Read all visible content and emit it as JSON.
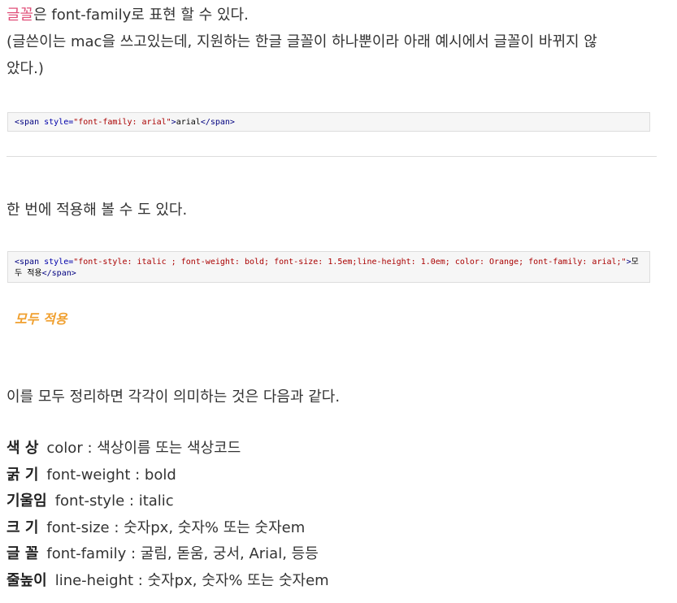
{
  "intro": {
    "highlight": "글꼴",
    "rest": "은 font-family로 표현 할 수 있다.",
    "note_line1": "(글쓴이는 mac을 쓰고있는데, 지원하는 한글 글꼴이 하나뿐이라 아래 예시에서 글꼴이 바뀌지 않",
    "note_line2": "았다.)"
  },
  "code1": {
    "open": "<span ",
    "attr": "style=",
    "value": "\"font-family: arial\"",
    "close_open": ">",
    "text": "arial",
    "end": "</span>"
  },
  "section2": {
    "text": "한 번에 적용해 볼 수 도 있다."
  },
  "code2": {
    "open": "<span ",
    "attr": "style=",
    "value": "\"font-style: italic ; font-weight: bold; font-size: 1.5em;line-height: 1.0em; color: Orange; font-family: arial;\"",
    "close_open": ">",
    "text": "모두 적용",
    "end": "</span>"
  },
  "demo": {
    "text": "모두 적용",
    "color": "#f0a030"
  },
  "summary": {
    "text": "이를 모두 정리하면 각각이 의미하는 것은 다음과 같다."
  },
  "properties": [
    {
      "label": "색 상",
      "name": "color",
      "sep": " : ",
      "value": "색상이름 또는 색상코드"
    },
    {
      "label": "굵 기",
      "name": "font-weight",
      "sep": " : ",
      "value": "bold"
    },
    {
      "label": "기울임",
      "name": "font-style",
      "sep": " : ",
      "value": "italic"
    },
    {
      "label": "크 기",
      "name": "font-size",
      "sep": " : ",
      "value": "숫자px, 숫자% 또는 숫자em"
    },
    {
      "label": "글 꼴",
      "name": "font-family",
      "sep": " : ",
      "value": "굴림, 돋움, 궁서, Arial, 등등"
    },
    {
      "label": "줄높이",
      "name": "line-height",
      "sep": " : ",
      "value": "숫자px, 숫자% 또는 숫자em"
    }
  ],
  "colors": {
    "highlight": "#e0507a",
    "text": "#333333",
    "code_bg": "#f6f6f6",
    "demo_orange": "#f0a030"
  }
}
